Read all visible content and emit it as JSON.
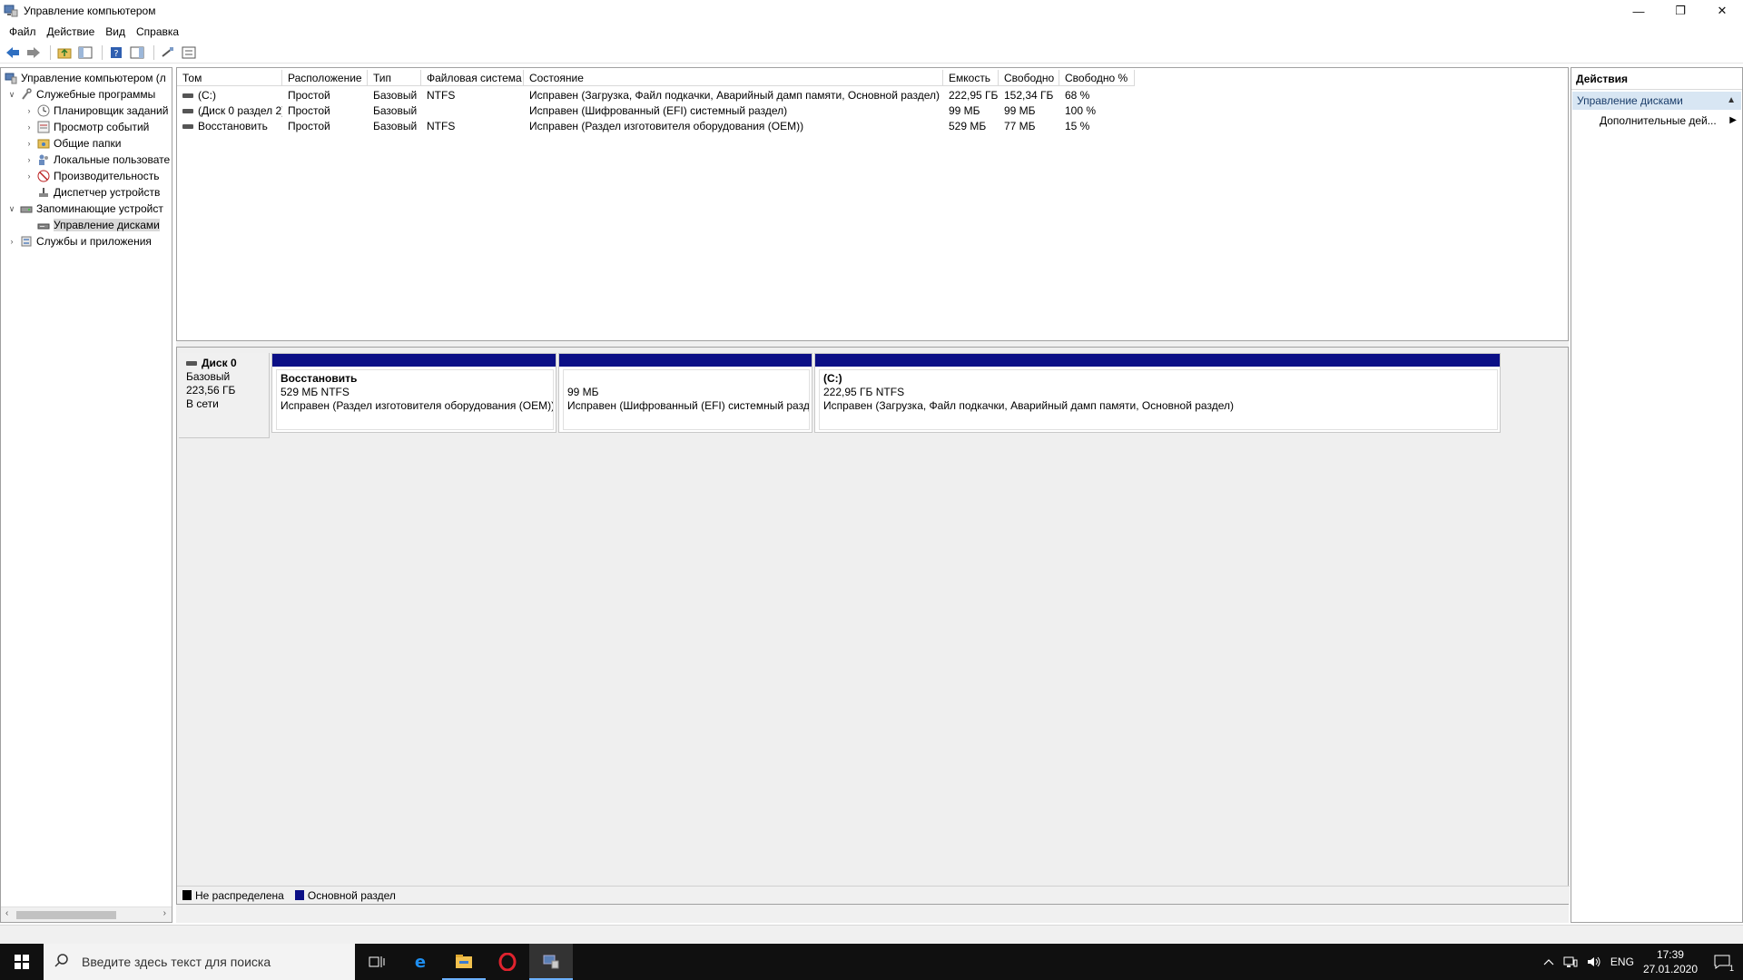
{
  "window": {
    "title": "Управление компьютером",
    "controls": {
      "minimize": "—",
      "restore": "❐",
      "close": "✕"
    }
  },
  "menu": [
    "Файл",
    "Действие",
    "Вид",
    "Справка"
  ],
  "tree": {
    "items": [
      {
        "label": "Управление компьютером (л",
        "exp": "",
        "level": 0,
        "icon": "computer-management-icon"
      },
      {
        "label": "Служебные программы",
        "exp": "∨",
        "level": 1,
        "icon": "tools-icon"
      },
      {
        "label": "Планировщик заданий",
        "exp": "›",
        "level": 2,
        "icon": "clock-icon"
      },
      {
        "label": "Просмотр событий",
        "exp": "›",
        "level": 2,
        "icon": "event-viewer-icon"
      },
      {
        "label": "Общие папки",
        "exp": "›",
        "level": 2,
        "icon": "shared-folders-icon"
      },
      {
        "label": "Локальные пользовате",
        "exp": "›",
        "level": 2,
        "icon": "users-icon"
      },
      {
        "label": "Производительность",
        "exp": "›",
        "level": 2,
        "icon": "performance-icon"
      },
      {
        "label": "Диспетчер устройств",
        "exp": "",
        "level": 2,
        "icon": "device-manager-icon"
      },
      {
        "label": "Запоминающие устройст",
        "exp": "∨",
        "level": 1,
        "icon": "storage-icon"
      },
      {
        "label": "Управление дисками",
        "exp": "",
        "level": 2,
        "icon": "disk-management-icon",
        "selected": true
      },
      {
        "label": "Службы и приложения",
        "exp": "›",
        "level": 1,
        "icon": "services-icon"
      }
    ]
  },
  "volumes": {
    "columns": [
      "Том",
      "Расположение",
      "Тип",
      "Файловая система",
      "Состояние",
      "Емкость",
      "Свободно",
      "Свободно %"
    ],
    "rows": [
      [
        "(C:)",
        "Простой",
        "Базовый",
        "NTFS",
        "Исправен (Загрузка, Файл подкачки, Аварийный дамп памяти, Основной раздел)",
        "222,95 ГБ",
        "152,34 ГБ",
        "68 %"
      ],
      [
        "(Диск 0 раздел 2)",
        "Простой",
        "Базовый",
        "",
        "Исправен (Шифрованный (EFI) системный раздел)",
        "99 МБ",
        "99 МБ",
        "100 %"
      ],
      [
        "Восстановить",
        "Простой",
        "Базовый",
        "NTFS",
        "Исправен (Раздел изготовителя оборудования (OEM))",
        "529 МБ",
        "77 МБ",
        "15 %"
      ]
    ]
  },
  "disk": {
    "name": "Диск 0",
    "type": "Базовый",
    "size": "223,56 ГБ",
    "status": "В сети",
    "partitions": [
      {
        "name": "Восстановить",
        "size": "529 МБ NTFS",
        "status": "Исправен (Раздел изготовителя оборудования (OEM))"
      },
      {
        "name": "",
        "size": "99 МБ",
        "status": "Исправен (Шифрованный (EFI) системный разде"
      },
      {
        "name": "(C:)",
        "size": "222,95 ГБ NTFS",
        "status": "Исправен (Загрузка, Файл подкачки, Аварийный дамп памяти, Основной раздел)"
      }
    ]
  },
  "legend": [
    {
      "label": "Не распределена",
      "color": "#000000"
    },
    {
      "label": "Основной раздел",
      "color": "#0b0f86"
    }
  ],
  "actions": {
    "header": "Действия",
    "section": "Управление дисками",
    "item": "Дополнительные дей..."
  },
  "taskbar": {
    "search_placeholder": "Введите здесь текст для поиска",
    "lang": "ENG",
    "time": "17:39",
    "date": "27.01.2020",
    "notif_count": "1"
  }
}
